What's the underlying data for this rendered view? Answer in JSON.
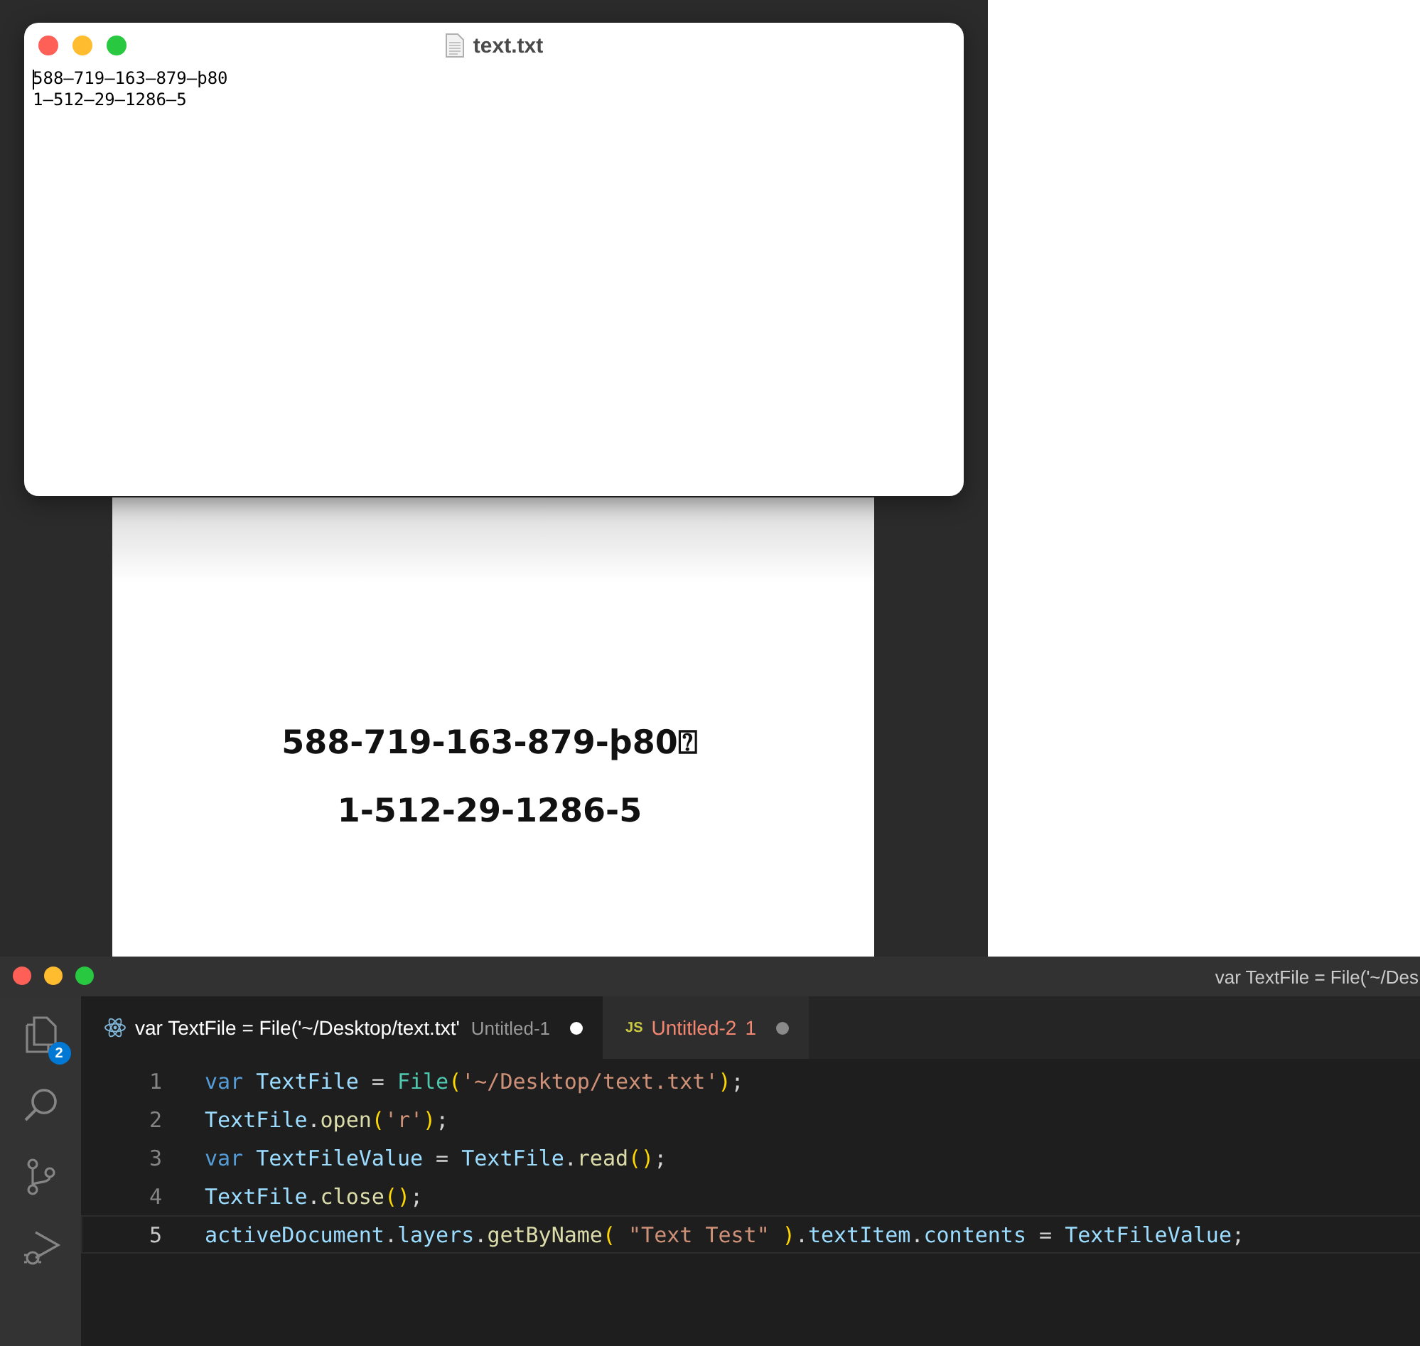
{
  "textedit": {
    "title": "text.txt",
    "lines": [
      "588–719–163–879–þ80",
      "1–512–29–1286–5"
    ]
  },
  "document": {
    "lines": [
      "588-719-163-879-þ80⍰",
      "1-512-29-1286-5"
    ]
  },
  "editor": {
    "title": "var TextFile = File('~/Des",
    "activity": [
      {
        "kind": "files",
        "badge": "2",
        "selected": false
      },
      {
        "kind": "search",
        "selected": false
      },
      {
        "kind": "scm",
        "selected": false
      },
      {
        "kind": "debug",
        "selected": false
      }
    ],
    "tabs": [
      {
        "kind": "react",
        "label": "var TextFile = File('~/Desktop/text.txt'",
        "description": "Untitled-1",
        "modified": true,
        "selected": true
      },
      {
        "kind": "js",
        "icon_text": "JS",
        "label": "Untitled-2",
        "problems": "1",
        "modified": true,
        "selected": false
      }
    ],
    "lines": [
      {
        "number": "1",
        "current": false,
        "tokens": [
          {
            "text": "var ",
            "kind": "keyword"
          },
          {
            "text": "TextFile",
            "kind": "variable"
          },
          {
            "text": " = ",
            "kind": "punct"
          },
          {
            "text": "File",
            "kind": "class"
          },
          {
            "text": "(",
            "kind": "bracket"
          },
          {
            "text": "'~/Desktop/text.txt'",
            "kind": "string"
          },
          {
            "text": ")",
            "kind": "bracket"
          },
          {
            "text": ";",
            "kind": "punct"
          }
        ]
      },
      {
        "number": "2",
        "current": false,
        "tokens": [
          {
            "text": "TextFile",
            "kind": "variable"
          },
          {
            "text": ".",
            "kind": "punct"
          },
          {
            "text": "open",
            "kind": "function"
          },
          {
            "text": "(",
            "kind": "bracket"
          },
          {
            "text": "'r'",
            "kind": "string"
          },
          {
            "text": ")",
            "kind": "bracket"
          },
          {
            "text": ";",
            "kind": "punct"
          }
        ]
      },
      {
        "number": "3",
        "current": false,
        "tokens": [
          {
            "text": "var ",
            "kind": "keyword"
          },
          {
            "text": "TextFileValue",
            "kind": "variable"
          },
          {
            "text": " = ",
            "kind": "punct"
          },
          {
            "text": "TextFile",
            "kind": "variable"
          },
          {
            "text": ".",
            "kind": "punct"
          },
          {
            "text": "read",
            "kind": "function"
          },
          {
            "text": "()",
            "kind": "bracket"
          },
          {
            "text": ";",
            "kind": "punct"
          }
        ]
      },
      {
        "number": "4",
        "current": false,
        "tokens": [
          {
            "text": "TextFile",
            "kind": "variable"
          },
          {
            "text": ".",
            "kind": "punct"
          },
          {
            "text": "close",
            "kind": "function"
          },
          {
            "text": "()",
            "kind": "bracket"
          },
          {
            "text": ";",
            "kind": "punct"
          }
        ]
      },
      {
        "number": "5",
        "current": true,
        "tokens": [
          {
            "text": "activeDocument",
            "kind": "variable"
          },
          {
            "text": ".",
            "kind": "punct"
          },
          {
            "text": "layers",
            "kind": "variable"
          },
          {
            "text": ".",
            "kind": "punct"
          },
          {
            "text": "getByName",
            "kind": "function"
          },
          {
            "text": "( ",
            "kind": "bracket"
          },
          {
            "text": "\"Text Test\"",
            "kind": "string"
          },
          {
            "text": " )",
            "kind": "bracket"
          },
          {
            "text": ".",
            "kind": "punct"
          },
          {
            "text": "textItem",
            "kind": "variable"
          },
          {
            "text": ".",
            "kind": "punct"
          },
          {
            "text": "contents",
            "kind": "variable"
          },
          {
            "text": " = ",
            "kind": "punct"
          },
          {
            "text": "TextFileValue",
            "kind": "variable"
          },
          {
            "text": ";",
            "kind": "punct"
          }
        ]
      }
    ]
  }
}
